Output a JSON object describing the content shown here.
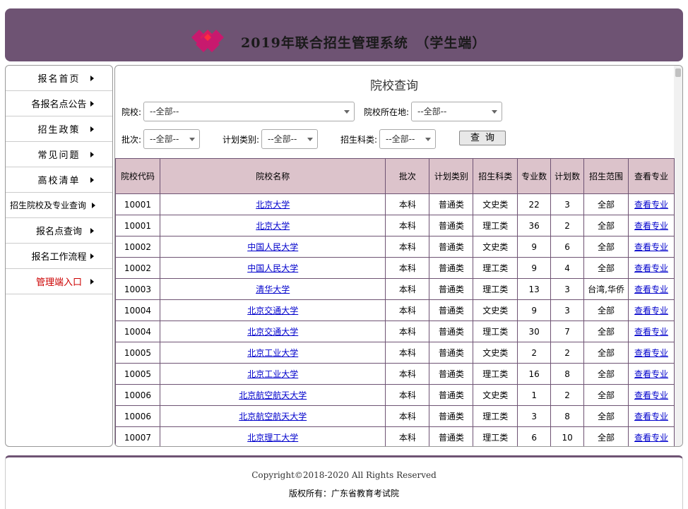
{
  "header": {
    "title": "2019年联合招生管理系统　（学生端）",
    "logo_colors": [
      "#c8196e",
      "#e0245e"
    ]
  },
  "sidebar": {
    "items": [
      {
        "label": "报名首页"
      },
      {
        "label": "各报名点公告"
      },
      {
        "label": "招生政策"
      },
      {
        "label": "常见问题"
      },
      {
        "label": "高校清单"
      },
      {
        "label": "招生院校及专业查询"
      },
      {
        "label": "报名点查询"
      },
      {
        "label": "报名工作流程"
      },
      {
        "label": "管理端入口"
      }
    ]
  },
  "main": {
    "title": "院校查询",
    "filters": {
      "school_label": "院校:",
      "school_value": "--全部--",
      "location_label": "院校所在地:",
      "location_value": "--全部--",
      "batch_label": "批次:",
      "batch_value": "--全部--",
      "plan_label": "计划类别:",
      "plan_value": "--全部--",
      "subject_label": "招生科类:",
      "subject_value": "--全部--",
      "query_button": "查询"
    },
    "table": {
      "headers": [
        "院校代码",
        "院校名称",
        "批次",
        "计划类别",
        "招生科类",
        "专业数",
        "计划数",
        "招生范围",
        "查看专业"
      ],
      "rows": [
        {
          "code": "10001",
          "name": "北京大学",
          "batch": "本科",
          "plan": "普通类",
          "subject": "文史类",
          "majors": "22",
          "quota": "3",
          "scope": "全部",
          "link": "查看专业"
        },
        {
          "code": "10001",
          "name": "北京大学",
          "batch": "本科",
          "plan": "普通类",
          "subject": "理工类",
          "majors": "36",
          "quota": "2",
          "scope": "全部",
          "link": "查看专业"
        },
        {
          "code": "10002",
          "name": "中国人民大学",
          "batch": "本科",
          "plan": "普通类",
          "subject": "文史类",
          "majors": "9",
          "quota": "6",
          "scope": "全部",
          "link": "查看专业"
        },
        {
          "code": "10002",
          "name": "中国人民大学",
          "batch": "本科",
          "plan": "普通类",
          "subject": "理工类",
          "majors": "9",
          "quota": "4",
          "scope": "全部",
          "link": "查看专业"
        },
        {
          "code": "10003",
          "name": "清华大学",
          "batch": "本科",
          "plan": "普通类",
          "subject": "理工类",
          "majors": "13",
          "quota": "3",
          "scope": "台湾,华侨",
          "link": "查看专业"
        },
        {
          "code": "10004",
          "name": "北京交通大学",
          "batch": "本科",
          "plan": "普通类",
          "subject": "文史类",
          "majors": "9",
          "quota": "3",
          "scope": "全部",
          "link": "查看专业"
        },
        {
          "code": "10004",
          "name": "北京交通大学",
          "batch": "本科",
          "plan": "普通类",
          "subject": "理工类",
          "majors": "30",
          "quota": "7",
          "scope": "全部",
          "link": "查看专业"
        },
        {
          "code": "10005",
          "name": "北京工业大学",
          "batch": "本科",
          "plan": "普通类",
          "subject": "文史类",
          "majors": "2",
          "quota": "2",
          "scope": "全部",
          "link": "查看专业"
        },
        {
          "code": "10005",
          "name": "北京工业大学",
          "batch": "本科",
          "plan": "普通类",
          "subject": "理工类",
          "majors": "16",
          "quota": "8",
          "scope": "全部",
          "link": "查看专业"
        },
        {
          "code": "10006",
          "name": "北京航空航天大学",
          "batch": "本科",
          "plan": "普通类",
          "subject": "文史类",
          "majors": "1",
          "quota": "2",
          "scope": "全部",
          "link": "查看专业"
        },
        {
          "code": "10006",
          "name": "北京航空航天大学",
          "batch": "本科",
          "plan": "普通类",
          "subject": "理工类",
          "majors": "3",
          "quota": "8",
          "scope": "全部",
          "link": "查看专业"
        },
        {
          "code": "10007",
          "name": "北京理工大学",
          "batch": "本科",
          "plan": "普通类",
          "subject": "理工类",
          "majors": "6",
          "quota": "10",
          "scope": "全部",
          "link": "查看专业"
        }
      ]
    }
  },
  "footer": {
    "copyright": "Copyright©2018-2020 All Rights Reserved",
    "owner": "版权所有：广东省教育考试院"
  }
}
